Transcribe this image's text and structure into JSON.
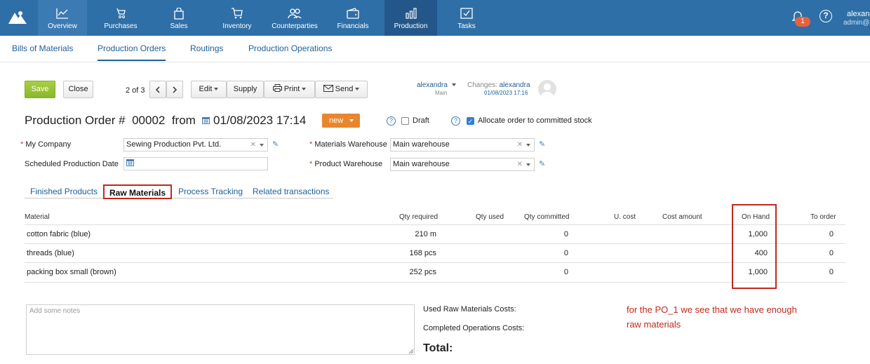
{
  "nav": {
    "items": [
      {
        "label": "Overview",
        "icon": "chart-line-icon"
      },
      {
        "label": "Purchases",
        "icon": "shopping-bag-icon"
      },
      {
        "label": "Sales",
        "icon": "bag-icon"
      },
      {
        "label": "Inventory",
        "icon": "cart-icon"
      },
      {
        "label": "Counterparties",
        "icon": "people-icon"
      },
      {
        "label": "Financials",
        "icon": "wallet-icon"
      },
      {
        "label": "Production",
        "icon": "bar-chart-icon"
      },
      {
        "label": "Tasks",
        "icon": "checkbox-icon"
      }
    ],
    "notifications_count": "1",
    "help": "?",
    "user_name": "alexandra",
    "user_email": "admin@a"
  },
  "subnav": {
    "items": [
      "Bills of Materials",
      "Production Orders",
      "Routings",
      "Production Operations"
    ]
  },
  "toolbar": {
    "save": "Save",
    "close": "Close",
    "pager": "2 of 3",
    "edit": "Edit",
    "supply": "Supply",
    "print": "Print",
    "send": "Send",
    "owner": "alexandra",
    "owner_sub": "Main",
    "changes_label": "Changes:",
    "changes_user": "alexandra",
    "changes_date": "01/08/2023 17:16"
  },
  "order": {
    "title_prefix": "Production Order #",
    "number": "00002",
    "from": "from",
    "date": "01/08/2023 17:14",
    "status": "new",
    "draft_label": "Draft",
    "allocate_label": "Allocate order to committed stock"
  },
  "form": {
    "my_company_label": "My Company",
    "my_company_value": "Sewing Production Pvt. Ltd.",
    "scheduled_label": "Scheduled Production Date",
    "materials_wh_label": "Materials Warehouse",
    "materials_wh_value": "Main warehouse",
    "product_wh_label": "Product Warehouse",
    "product_wh_value": "Main warehouse"
  },
  "tabs": [
    "Finished Products",
    "Raw Materials",
    "Process Tracking",
    "Related transactions"
  ],
  "table": {
    "headers": [
      "Material",
      "Qty required",
      "Qty used",
      "Qty committed",
      "U. cost",
      "Cost amount",
      "On Hand",
      "To order"
    ],
    "rows": [
      {
        "material": "cotton fabric (blue)",
        "qty_required": "210 m",
        "qty_committed": "0",
        "on_hand": "1,000",
        "to_order": "0"
      },
      {
        "material": "threads (blue)",
        "qty_required": "168 pcs",
        "qty_committed": "0",
        "on_hand": "400",
        "to_order": "0"
      },
      {
        "material": "packing box small (brown)",
        "qty_required": "252 pcs",
        "qty_committed": "0",
        "on_hand": "1,000",
        "to_order": "0"
      }
    ]
  },
  "bottom": {
    "notes_placeholder": "Add some notes",
    "used_costs": "Used Raw Materials Costs:",
    "completed_costs": "Completed Operations Costs:",
    "total": "Total:"
  },
  "annotation": {
    "line1": "for the PO_1 we see that we have enough",
    "line2": "raw materials"
  },
  "colors": {
    "topbar": "#2f6fa7",
    "accent": "#1f5f95",
    "save": "#8bb72b",
    "status": "#e8862e",
    "highlight": "#c0281e"
  }
}
